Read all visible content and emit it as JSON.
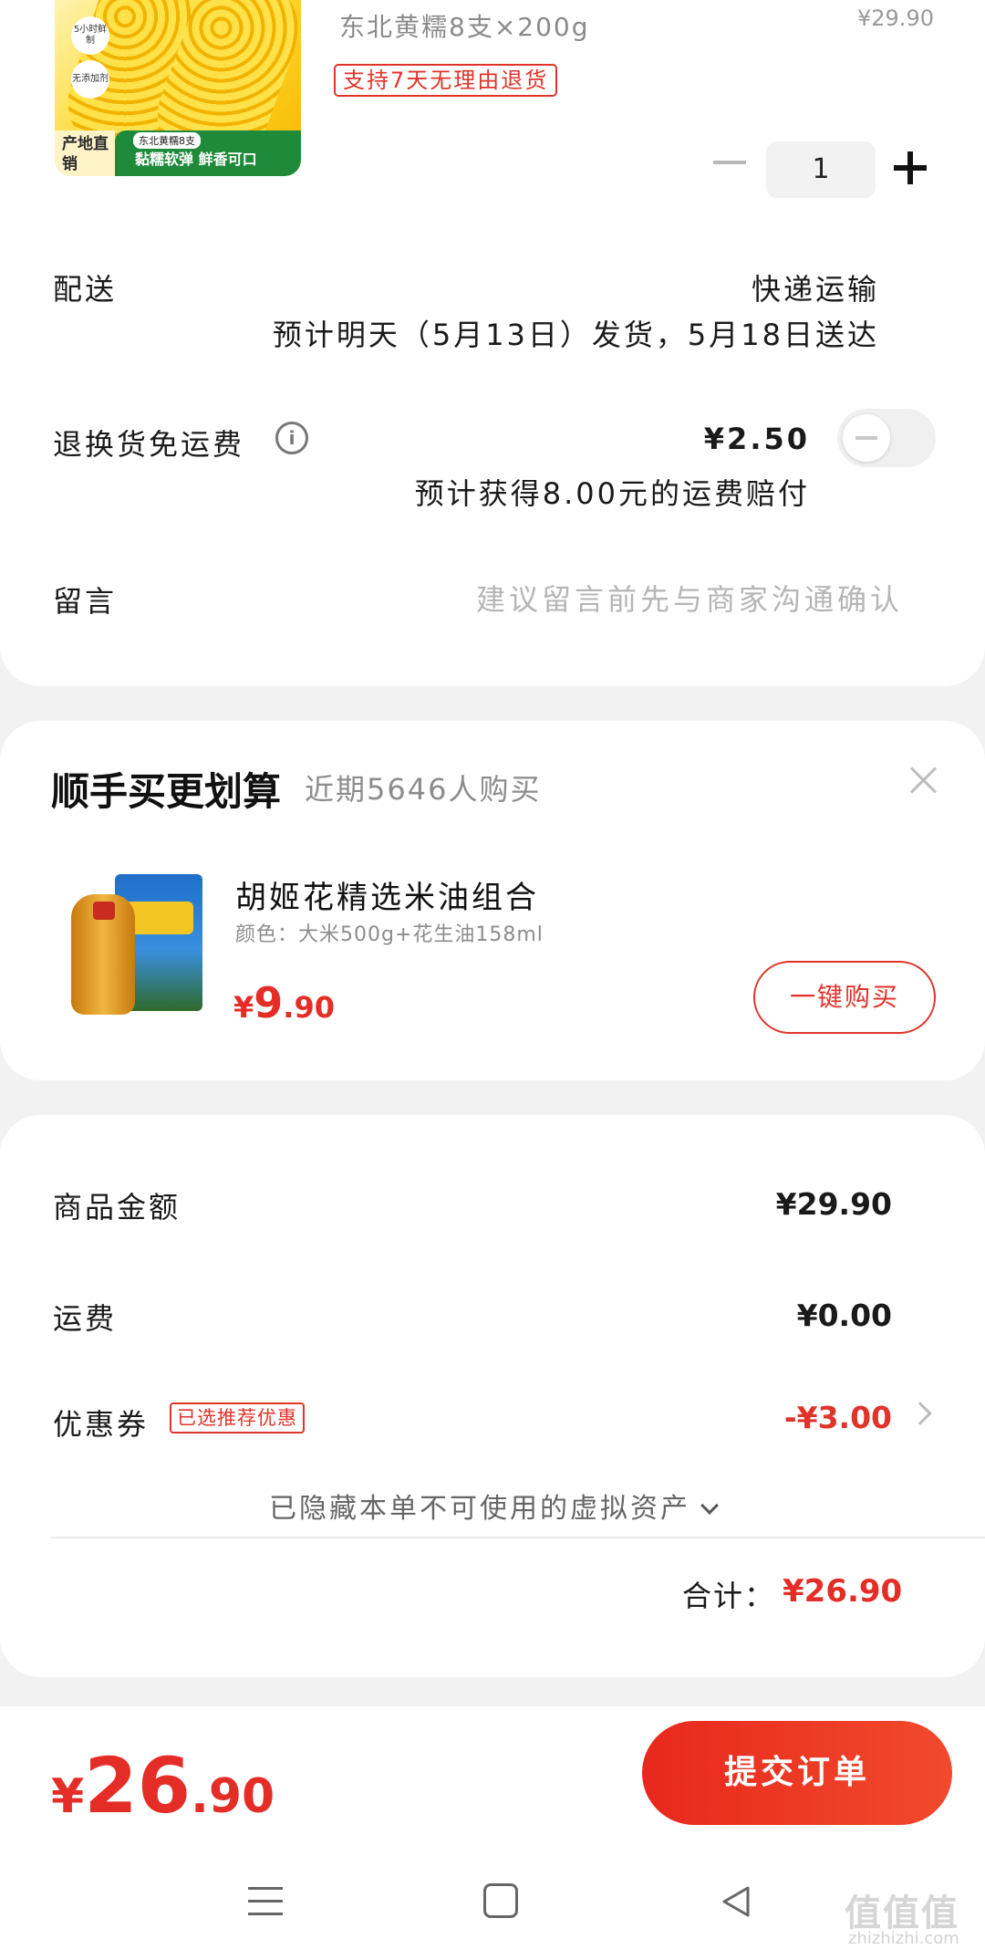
{
  "product": {
    "image_badges": [
      "5小时鲜制",
      "无添加剂"
    ],
    "image_origin": "产地直销",
    "image_pack_label": "东北黄糯8支",
    "image_slogan": "黏糯软弹 鲜香可口",
    "title": "东北黄糯8支×200g",
    "price": "¥29.90",
    "return_tag": "支持7天无理由退货",
    "quantity": "1"
  },
  "delivery": {
    "label": "配送",
    "method": "快递运输",
    "estimate": "预计明天（5月13日）发货，5月18日送达"
  },
  "return_shipping": {
    "label": "退换货免运费",
    "price": "¥2.50",
    "note": "预计获得8.00元的运费赔付"
  },
  "message": {
    "label": "留言",
    "placeholder": "建议留言前先与商家沟通确认"
  },
  "recommend": {
    "title": "顺手买更划算",
    "count_text": "近期5646人购买",
    "item_name": "胡姬花精选米油组合",
    "item_spec": "颜色：大米500g+花生油158ml",
    "price_yen": "¥",
    "price_int": "9",
    "price_dec": ".90",
    "buy_label": "一键购买"
  },
  "summary": {
    "goods_label": "商品金额",
    "goods_value": "¥29.90",
    "shipping_label": "运费",
    "shipping_value": "¥0.00",
    "coupon_label": "优惠券",
    "coupon_tag": "已选推荐优惠",
    "coupon_value": "-¥3.00",
    "hidden_assets": "已隐藏本单不可使用的虚拟资产",
    "total_label": "合计：",
    "total_value": "¥26.90"
  },
  "checkout": {
    "yen": "¥",
    "int": "26",
    "dec": ".90",
    "submit_label": "提交订单"
  },
  "watermark": {
    "main": "值值值",
    "sub": "zhizhizhi.com"
  },
  "colors": {
    "accent": "#e52d27",
    "button_gradient_start": "#e8281d",
    "button_gradient_end": "#f14a2c"
  }
}
